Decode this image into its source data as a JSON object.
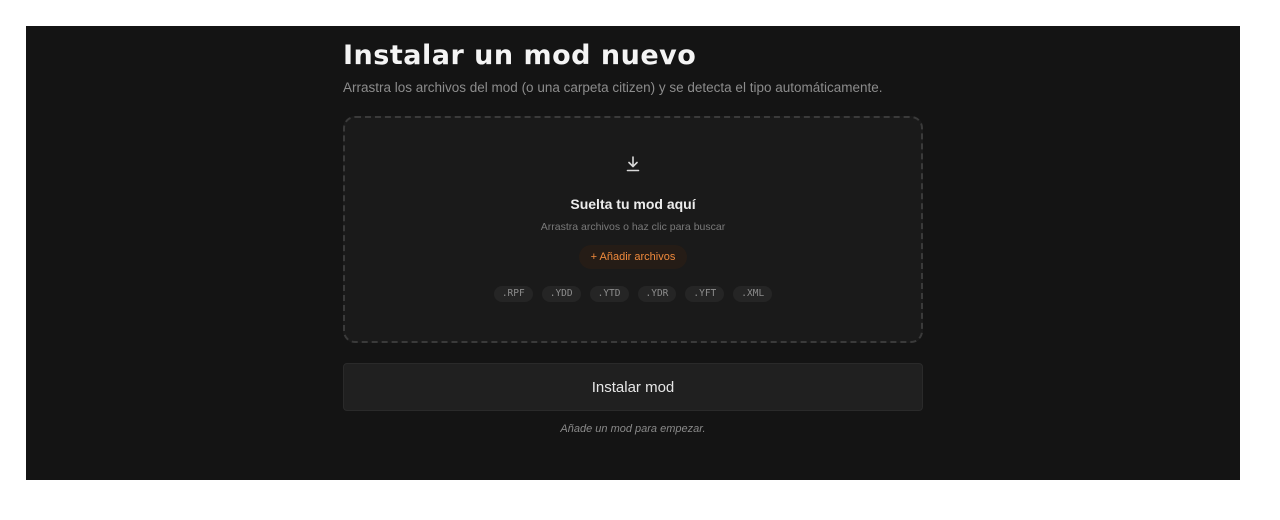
{
  "page": {
    "title": "Instalar un mod nuevo",
    "subtitle": "Arrastra los archivos del mod (o una carpeta citizen) y se detecta el tipo automáticamente."
  },
  "dropzone": {
    "icon": "download-icon",
    "title": "Suelta tu mod aquí",
    "hint": "Arrastra archivos o haz clic para buscar",
    "add_button_label": "+ Añadir archivos",
    "extensions": [
      ".RPF",
      ".YDD",
      ".YTD",
      ".YDR",
      ".YFT",
      ".XML"
    ]
  },
  "install": {
    "button_label": "Instalar mod",
    "status_text": "Añade un mod para empezar."
  },
  "colors": {
    "background": "#141414",
    "accent": "#f08a3c",
    "text_primary": "#f4f4f4",
    "text_muted": "#8c8c8c"
  }
}
